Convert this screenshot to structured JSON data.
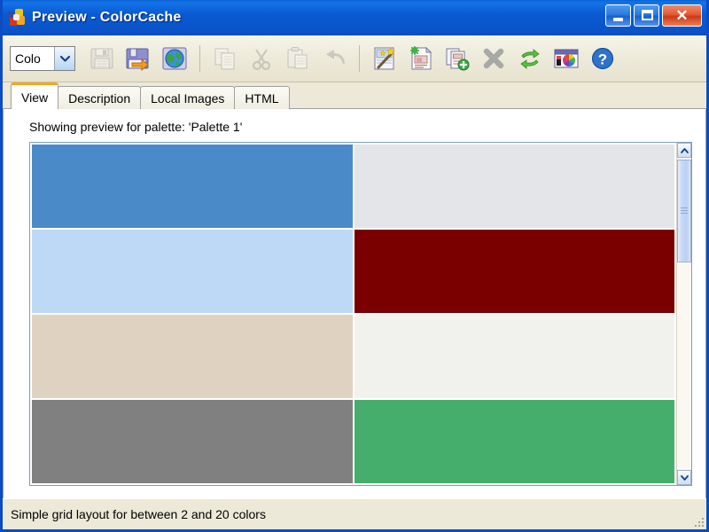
{
  "window": {
    "title": "Preview - ColorCache",
    "app_icon": "colorcache-icon",
    "buttons": {
      "minimize": "_",
      "maximize": "□",
      "close": "✕"
    }
  },
  "toolbar": {
    "combo": {
      "value": "Colo",
      "arrow_icon": "chevron-down-icon"
    },
    "items": [
      {
        "name": "save-button",
        "icon": "floppy-disk-icon",
        "disabled": true
      },
      {
        "name": "save-as-button",
        "icon": "floppy-disk-arrow-icon",
        "disabled": false
      },
      {
        "name": "open-web-button",
        "icon": "globe-icon",
        "disabled": false
      },
      {
        "name": "separator-1",
        "icon": "separator",
        "disabled": true
      },
      {
        "name": "copy-button",
        "icon": "copy-pages-icon",
        "disabled": true
      },
      {
        "name": "cut-button",
        "icon": "scissors-icon",
        "disabled": true
      },
      {
        "name": "paste-button",
        "icon": "clipboard-icon",
        "disabled": true
      },
      {
        "name": "undo-button",
        "icon": "undo-arrow-icon",
        "disabled": true
      },
      {
        "name": "separator-2",
        "icon": "separator",
        "disabled": true
      },
      {
        "name": "magic-wand-button",
        "icon": "magic-wand-page-icon",
        "disabled": false
      },
      {
        "name": "new-palette-button",
        "icon": "new-page-sparkle-icon",
        "disabled": false
      },
      {
        "name": "add-page-button",
        "icon": "page-add-plus-icon",
        "disabled": false
      },
      {
        "name": "delete-button",
        "icon": "grey-x-icon",
        "disabled": true
      },
      {
        "name": "refresh-button",
        "icon": "green-refresh-icon",
        "disabled": false
      },
      {
        "name": "color-picker-button",
        "icon": "color-wheel-window-icon",
        "disabled": false
      },
      {
        "name": "help-button",
        "icon": "question-mark-icon",
        "disabled": false
      }
    ]
  },
  "tabs": [
    {
      "label": "View",
      "active": true
    },
    {
      "label": "Description",
      "active": false
    },
    {
      "label": "Local Images",
      "active": false
    },
    {
      "label": "HTML",
      "active": false
    }
  ],
  "main": {
    "preview_label": "Showing preview for palette: 'Palette 1'",
    "palette_name": "Palette 1",
    "swatch_rows": [
      [
        "#4a8ac9",
        "#e3e5e8"
      ],
      [
        "#bdd9f5",
        "#7a0000"
      ],
      [
        "#e0d2c0",
        "#f1f1ee"
      ],
      [
        "#808080",
        "#46ae6c"
      ]
    ],
    "scrollbar": {
      "up_icon": "chevron-up-icon",
      "down_icon": "chevron-down-icon",
      "thumb_position_percent": 0,
      "thumb_size_percent": 33
    }
  },
  "statusbar": {
    "text": "Simple grid layout for between 2 and 20 colors",
    "grip_icon": "resize-grip-icon"
  }
}
